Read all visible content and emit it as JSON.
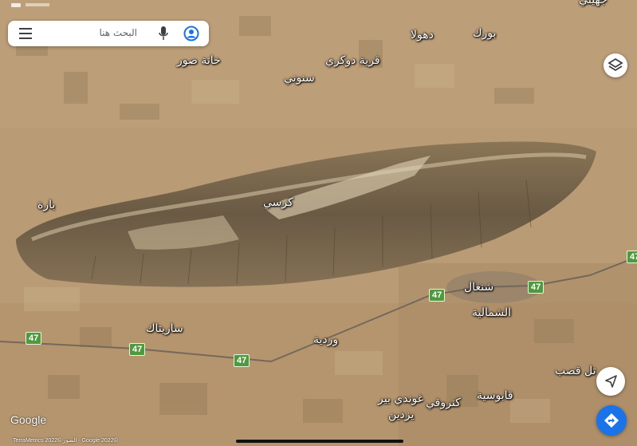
{
  "search": {
    "placeholder": "البحث هنا"
  },
  "places": [
    {
      "id": "khanat-sawr",
      "name": "خانة صور"
    },
    {
      "id": "qaryat-dokri",
      "name": "قرية دوكري"
    },
    {
      "id": "sanuni",
      "name": "سنوني"
    },
    {
      "id": "dhula",
      "name": "دهولا"
    },
    {
      "id": "burk",
      "name": "بورك"
    },
    {
      "id": "top-right-partial",
      "name": "جهيلي"
    },
    {
      "id": "bara",
      "name": "بارة"
    },
    {
      "id": "karsi",
      "name": "كرسي"
    },
    {
      "id": "shanghal",
      "name": "شنغال"
    },
    {
      "id": "al-shamaliya",
      "name": "الشمالية"
    },
    {
      "id": "saryatak",
      "name": "ساريتاك"
    },
    {
      "id": "wardiya",
      "name": "وردية"
    },
    {
      "id": "tal-qasab",
      "name": "تل قصب"
    },
    {
      "id": "qabusiya",
      "name": "قابوسية"
    },
    {
      "id": "kanruqi",
      "name": "كنروقي"
    },
    {
      "id": "ghundi-bir",
      "name": "غوندي بير"
    },
    {
      "id": "yazdin",
      "name": "يزدين"
    }
  ],
  "route": {
    "number": "47",
    "shield_color": "#4f9a3c",
    "shield_count": 6
  },
  "map_attribution": {
    "logo": "Google",
    "credits": "TerraMetrics 2022© ‏- الصور‏ Google 2022©"
  },
  "icons": {
    "menu": "hamburger-menu-icon",
    "mic": "microphone-icon",
    "account": "account-circle-icon",
    "layers": "layers-icon",
    "compass": "compass-arrow-icon",
    "directions": "directions-diamond-icon"
  },
  "colors": {
    "accent": "#1a73e8",
    "terrain": "#b89a74",
    "ridge": "#6b5a44"
  }
}
